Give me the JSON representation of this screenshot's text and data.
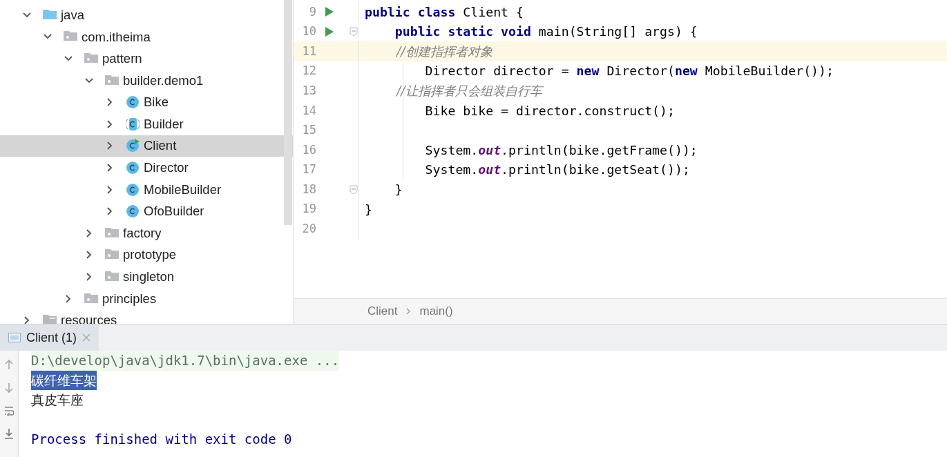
{
  "project_tree": {
    "items": [
      {
        "label": "java",
        "kind": "source-folder",
        "expanded": true,
        "selected": false,
        "children": [
          {
            "label": "com.itheima",
            "kind": "package",
            "expanded": true,
            "selected": false,
            "children": [
              {
                "label": "pattern",
                "kind": "package",
                "expanded": true,
                "selected": false,
                "children": [
                  {
                    "label": "builder.demo1",
                    "kind": "package",
                    "expanded": true,
                    "selected": false,
                    "children": [
                      {
                        "label": "Bike",
                        "kind": "class",
                        "expanded": false,
                        "selected": false
                      },
                      {
                        "label": "Builder",
                        "kind": "abstract-class",
                        "expanded": false,
                        "selected": false
                      },
                      {
                        "label": "Client",
                        "kind": "runnable-class",
                        "expanded": false,
                        "selected": true
                      },
                      {
                        "label": "Director",
                        "kind": "class",
                        "expanded": false,
                        "selected": false
                      },
                      {
                        "label": "MobileBuilder",
                        "kind": "class",
                        "expanded": false,
                        "selected": false
                      },
                      {
                        "label": "OfoBuilder",
                        "kind": "class",
                        "expanded": false,
                        "selected": false
                      }
                    ]
                  },
                  {
                    "label": "factory",
                    "kind": "package",
                    "expanded": false,
                    "selected": false
                  },
                  {
                    "label": "prototype",
                    "kind": "package",
                    "expanded": false,
                    "selected": false
                  },
                  {
                    "label": "singleton",
                    "kind": "package",
                    "expanded": false,
                    "selected": false
                  }
                ]
              },
              {
                "label": "principles",
                "kind": "package",
                "expanded": false,
                "selected": false
              }
            ]
          }
        ]
      },
      {
        "label": "resources",
        "kind": "resource-folder",
        "expanded": false,
        "selected": false
      }
    ]
  },
  "editor": {
    "lines": [
      {
        "number": "9",
        "run": true,
        "tokens": [
          {
            "kind": "keyword",
            "text": "public class"
          },
          {
            "kind": "plain",
            "text": " Client {"
          }
        ]
      },
      {
        "number": "10",
        "run": true,
        "fold": true,
        "tokens": [
          {
            "kind": "keyword",
            "text": "    public static void"
          },
          {
            "kind": "plain",
            "text": " main(String[] args) {"
          }
        ]
      },
      {
        "number": "11",
        "current": true,
        "tokens": [
          {
            "kind": "comment",
            "text": "        //创建指挥者对象"
          }
        ]
      },
      {
        "number": "12",
        "tokens": [
          {
            "kind": "plain",
            "text": "        Director director = "
          },
          {
            "kind": "keyword",
            "text": "new"
          },
          {
            "kind": "plain",
            "text": " Director("
          },
          {
            "kind": "keyword",
            "text": "new"
          },
          {
            "kind": "plain",
            "text": " MobileBuilder());"
          }
        ]
      },
      {
        "number": "13",
        "tokens": [
          {
            "kind": "comment",
            "text": "        //让指挥者只会组装自行车"
          }
        ]
      },
      {
        "number": "14",
        "tokens": [
          {
            "kind": "plain",
            "text": "        Bike bike = director.construct();"
          }
        ]
      },
      {
        "number": "15"
      },
      {
        "number": "16",
        "tokens": [
          {
            "kind": "plain",
            "text": "        System."
          },
          {
            "kind": "static-field",
            "text": "out"
          },
          {
            "kind": "plain",
            "text": ".println(bike.getFrame());"
          }
        ]
      },
      {
        "number": "17",
        "tokens": [
          {
            "kind": "plain",
            "text": "        System."
          },
          {
            "kind": "static-field",
            "text": "out"
          },
          {
            "kind": "plain",
            "text": ".println(bike.getSeat());"
          }
        ]
      },
      {
        "number": "18",
        "fold": true,
        "tokens": [
          {
            "kind": "plain",
            "text": "    }"
          }
        ]
      },
      {
        "number": "19",
        "tokens": [
          {
            "kind": "plain",
            "text": "}"
          }
        ]
      },
      {
        "number": "20"
      }
    ],
    "breadcrumbs": [
      "Client",
      "main()"
    ]
  },
  "run_panel": {
    "tab": {
      "label": "Client (1)",
      "selected": true
    },
    "lines": [
      {
        "kind": "command",
        "text": "D:\\develop\\java\\jdk1.7\\bin\\java.exe ...",
        "selected": false
      },
      {
        "kind": "output",
        "text": "碳纤维车架",
        "selected": true
      },
      {
        "kind": "output",
        "text": "真皮车座",
        "selected": false
      },
      {
        "kind": "blank"
      },
      {
        "kind": "exit",
        "text": "Process finished with exit code 0",
        "selected": false
      }
    ]
  }
}
